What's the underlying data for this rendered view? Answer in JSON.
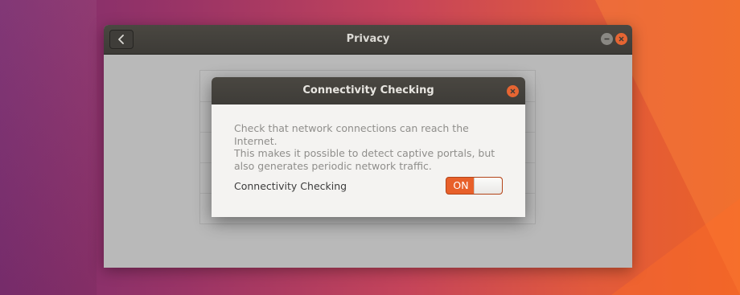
{
  "window": {
    "title": "Privacy",
    "back_icon": "chevron-left-icon",
    "minimize_icon": "minimize-icon",
    "close_icon": "close-icon"
  },
  "dialog": {
    "title": "Connectivity Checking",
    "close_icon": "close-icon",
    "description_lines": [
      "Check that network connections can reach the Internet.",
      "This makes it possible to detect captive portals, but",
      "also generates periodic network traffic."
    ],
    "setting": {
      "label": "Connectivity Checking",
      "switch_state": "ON"
    }
  },
  "colors": {
    "accent": "#e8602a",
    "titlebar": "#3d3b37"
  }
}
